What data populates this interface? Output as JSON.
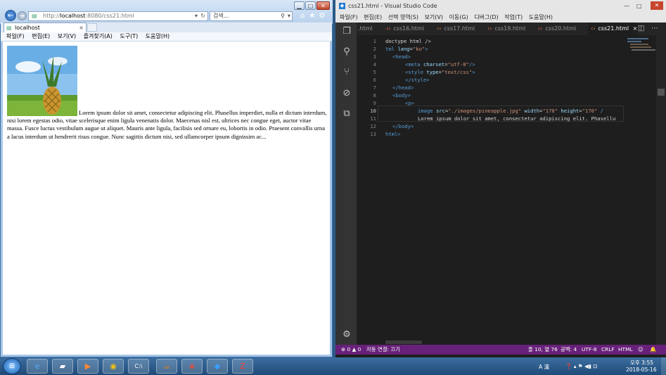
{
  "ie": {
    "address_prefix": "http://",
    "address_host": "localhost",
    "address_rest": ":8080/css21.html",
    "search_placeholder": "검색...",
    "tab_title": "localhost",
    "tab_close": "×",
    "menu": [
      "파일(F)",
      "편집(E)",
      "보기(V)",
      "즐겨찾기(A)",
      "도구(T)",
      "도움말(H)"
    ],
    "lorem": "Lorem ipsum dolor sit amet, consectetur adipiscing elit. Phasellus imperdiet, nulla et dictum interdum, nisi lorem egestas odio, vitae scelerisque enim ligula venenatis dolor. Maecenas nisl est, ultrices nec congue eget, auctor vitae massa. Fusce luctus vestibulum augue ut aliquet. Mauris ante ligula, facilisis sed ornare eu, lobortis in odio. Praesent convallis urna a lacus interdum ut hendrerit risus congue. Nunc sagittis dictum nisi, sed ullamcorper ipsum dignissim ac..."
  },
  "vscode": {
    "title": "css21.html - Visual Studio Code",
    "menu": [
      "파일(F)",
      "편집(E)",
      "선택 영역(S)",
      "보기(V)",
      "이동(G)",
      "디버그(D)",
      "작업(T)",
      "도움말(H)"
    ],
    "tabs": [
      ".html",
      "css16.html",
      "css17.html",
      "css19.html",
      "css20.html",
      "css21.html"
    ],
    "active_tab_index": 5,
    "tab_close": "×",
    "line_numbers": [
      "1",
      "2",
      "3",
      "4",
      "5",
      "6",
      "7",
      "8",
      "9",
      "10",
      "11",
      "12",
      "13"
    ],
    "code": {
      "l1": "doctype html />",
      "l2_a": "tml ",
      "l2_b": "lang",
      "l2_c": "=",
      "l2_d": "\"ko\"",
      "l2_e": ">",
      "l3": "<head>",
      "l4_a": "<meta ",
      "l4_b": "charset",
      "l4_c": "=",
      "l4_d": "\"utf-8\"",
      "l4_e": "/>",
      "l5_a": "<style ",
      "l5_b": "type",
      "l5_c": "=",
      "l5_d": "\"text/css\"",
      "l5_e": ">",
      "l6": "</style>",
      "l7": "</head>",
      "l8": "<body>",
      "l9": "<p>",
      "l10_a": "image ",
      "l10_b": "src",
      "l10_c": "=",
      "l10_d": "\"./images/pineapple.jpg\"",
      "l10_e": " width",
      "l10_f": "=",
      "l10_g": "\"170\"",
      "l10_h": " height",
      "l10_i": "=",
      "l10_j": "\"170\"",
      "l10_k": " /",
      "l11": "Lorem ipsum dolor sit amet, consectetur adipiscing elit. Phasellu",
      "l12": "</body>",
      "l13": "html>"
    },
    "status": {
      "errors": "⊗ 0 ▲ 0",
      "autosave": "자동 연결: 끄기",
      "position": "줄 10, 열 76",
      "spaces": "공백: 4",
      "encoding": "UTF-8",
      "eol": "CRLF",
      "language": "HTML",
      "feedback": "☺",
      "bell": "🔔"
    }
  },
  "taskbar": {
    "time": "오후 3:55",
    "date": "2018-05-16",
    "ime": "A 漢",
    "tray_icons": "❓ ▴ ⚑ ◀▮ ⊡"
  }
}
